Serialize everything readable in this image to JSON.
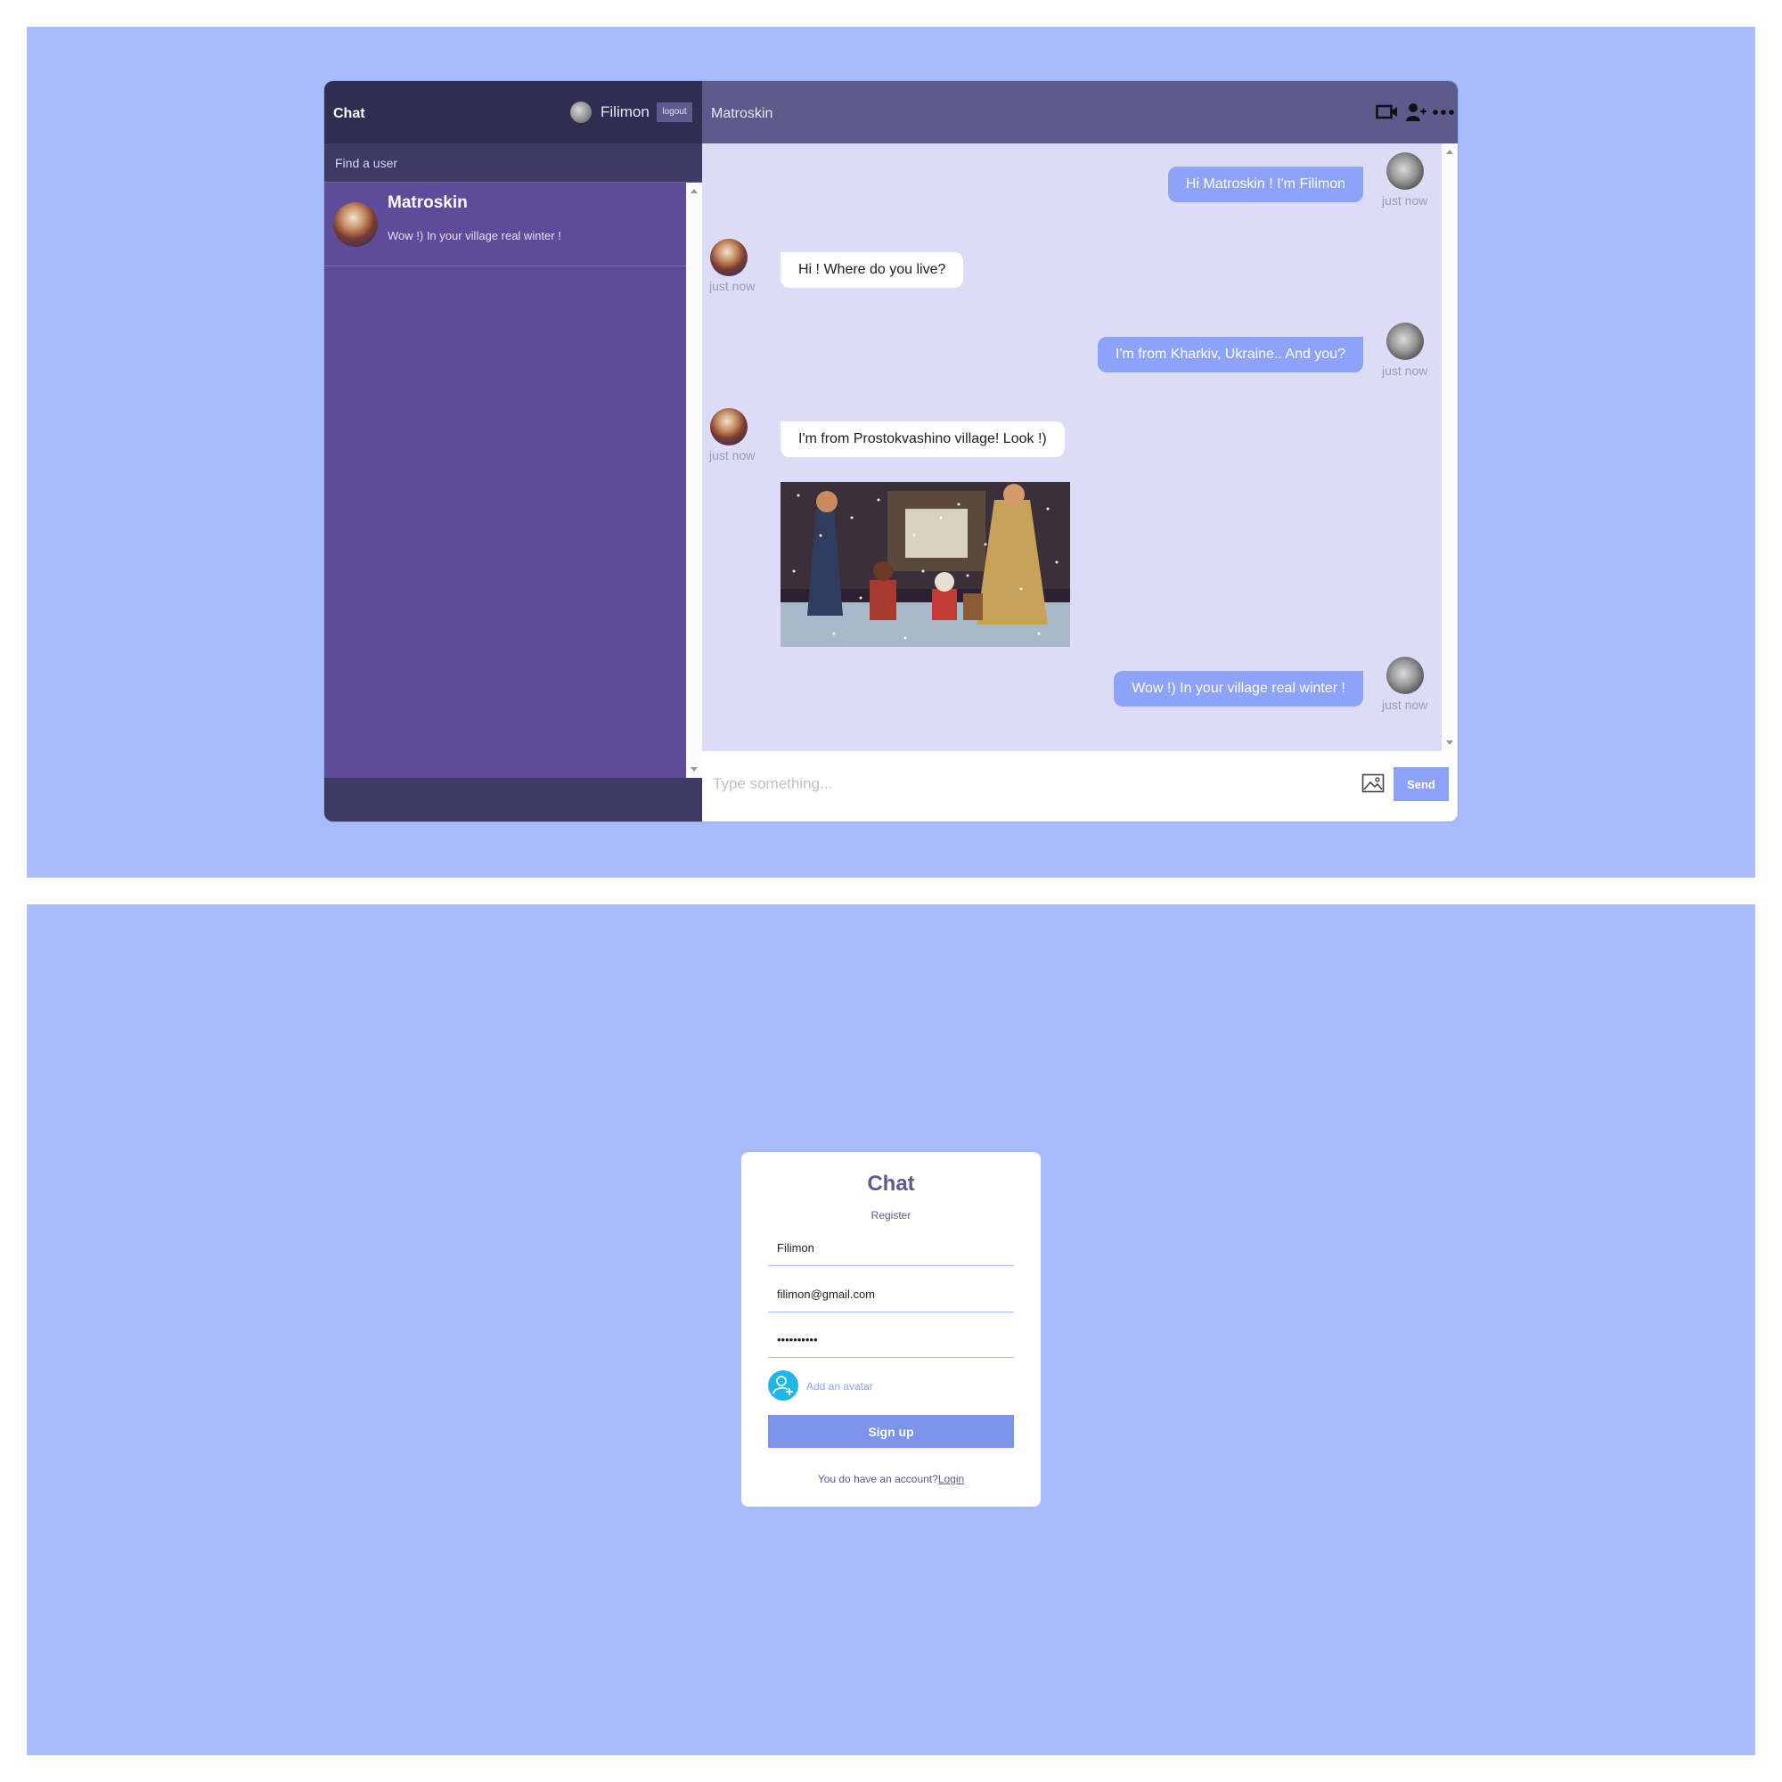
{
  "chat_app": {
    "logo": "Chat",
    "current_user": {
      "name": "Filimon",
      "logout_label": "logout"
    },
    "search": {
      "placeholder": "Find a user"
    },
    "chats": [
      {
        "name": "Matroskin",
        "last_message": "Wow !) In your village real winter !"
      }
    ],
    "active_chat": {
      "name": "Matroskin"
    },
    "header_icons": [
      "video-camera-icon",
      "add-user-icon",
      "more-icon"
    ],
    "messages": [
      {
        "from": "owner",
        "text": "Hi Matroskin ! I'm Filimon",
        "time": "just now"
      },
      {
        "from": "partner",
        "text": "Hi ! Where do you live?",
        "time": "just now"
      },
      {
        "from": "owner",
        "text": "I'm from Kharkiv, Ukraine.. And you?",
        "time": "just now"
      },
      {
        "from": "partner",
        "text": "I'm from Prostokvashino village! Look !)",
        "time": "just now",
        "image": "winter-village-cartoon"
      },
      {
        "from": "owner",
        "text": "Wow !) In your village real winter !",
        "time": "just now"
      }
    ],
    "input": {
      "placeholder": "Type something...",
      "send_label": "Send"
    }
  },
  "register_form": {
    "logo": "Chat",
    "title": "Register",
    "display_name": "Filimon",
    "email": "filimon@gmail.com",
    "password": "••••••••••",
    "avatar_label": "Add an avatar",
    "submit_label": "Sign up",
    "login_prompt": "You do have an account?",
    "login_link": "Login"
  },
  "colors": {
    "page_background": "#a7bbfd",
    "sidebar": "#5e4c9b",
    "navbar": "#2f2d52",
    "chat_header": "#5c5b8e",
    "chat_background": "#dddcf7",
    "owner_bubble": "#8da2f9",
    "button": "#7c93ea"
  }
}
